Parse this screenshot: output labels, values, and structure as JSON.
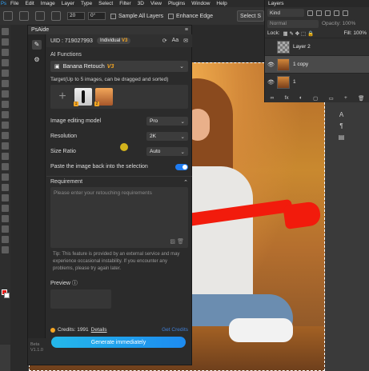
{
  "menu": [
    "File",
    "Edit",
    "Image",
    "Layer",
    "Type",
    "Select",
    "Filter",
    "3D",
    "View",
    "Plugins",
    "Window",
    "Help"
  ],
  "options": {
    "size_value": "20",
    "angle_value": "0°",
    "sample_all_layers": "Sample All Layers",
    "enhance_edge": "Enhance Edge",
    "select_btn": "Select S"
  },
  "panel": {
    "title": "PsAide",
    "uid": "UID : 719027993",
    "vip_label": "Individual",
    "vip_tag": "V3",
    "ai_functions_label": "AI Functions",
    "function_value": "Banana Retouch",
    "function_tag": "V3",
    "target_label": "Target(Up to 5 images, can be dragged and sorted)",
    "thumb1_num": "1",
    "thumb2_num": "2",
    "model_label": "Image editing model",
    "model_value": "Pro",
    "resolution_label": "Resolution",
    "resolution_value": "2K",
    "size_ratio_label": "Size Ratio",
    "size_ratio_value": "Auto",
    "paste_back_label": "Paste the image back into the selection",
    "requirement_label": "Requirement",
    "requirement_placeholder": "Please enter your retouching requirements",
    "tip": "Tip: This feature is provided by an external service and may experience occasional instability. If you encounter any problems, please try again later.",
    "preview_label": "Preview",
    "credits": "Credits: 1991",
    "details": "Details",
    "get_credits": "Get Credits",
    "generate": "Generate immediately",
    "beta": "Beta\nV1.1.0"
  },
  "layers": {
    "tab": "Layers",
    "kind": "Kind",
    "blend": "Normal",
    "opacity": "Opacity: 100%",
    "lock": "Lock:",
    "fill": "Fill: 100%",
    "items": [
      {
        "name": "Layer 2"
      },
      {
        "name": "1 copy"
      },
      {
        "name": "1"
      }
    ],
    "footer": [
      "fx",
      "◐",
      "▢",
      "▭",
      "+",
      "🗑"
    ]
  }
}
